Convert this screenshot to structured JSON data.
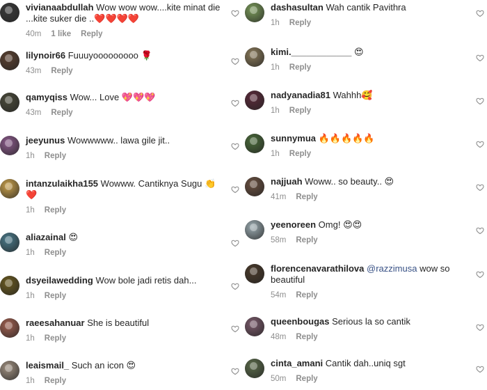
{
  "colors": {
    "text": "#262626",
    "secondary": "#8e8e8e",
    "mention": "#385185",
    "like": "#8e8e8e"
  },
  "left_comments": [
    {
      "username": "vivianaabdullah",
      "text": "Wow wow wow....kite minat die ...kite suker die ..❤️❤️❤️❤️",
      "time": "40m",
      "likes": "1 like",
      "reply": "Reply",
      "avatar_color": "#3a3a3a"
    },
    {
      "username": "lilynoir66",
      "text": "Fuuuyooooooooo 🌹",
      "time": "43m",
      "reply": "Reply",
      "avatar_color": "#5a4030"
    },
    {
      "username": "qamyqiss",
      "text": "Wow... Love 💖💖💖",
      "time": "43m",
      "reply": "Reply",
      "avatar_color": "#4a4a3a"
    },
    {
      "username": "jeeyunus",
      "text": "Wowwwww.. lawa gile jit..",
      "time": "1h",
      "reply": "Reply",
      "avatar_color": "#8a5a8a"
    },
    {
      "username": "intanzulaikha155",
      "text": "Wowww. Cantiknya Sugu 👏 ❤️",
      "time": "1h",
      "reply": "Reply",
      "avatar_color": "#c9a04a"
    },
    {
      "username": "aliazainal",
      "text": "😍",
      "time": "1h",
      "reply": "Reply",
      "avatar_color": "#4a7a8a"
    },
    {
      "username": "dsyeilawedding",
      "text": "Wow bole jadi retis dah...",
      "time": "1h",
      "reply": "Reply",
      "avatar_color": "#6a5a20"
    },
    {
      "username": "raeesahanuar",
      "text": "She is beautiful",
      "time": "1h",
      "reply": "Reply",
      "avatar_color": "#a06050"
    },
    {
      "username": "leaismail_",
      "text": "Such an icon 😍",
      "time": "1h",
      "reply": "Reply",
      "avatar_color": "#a09080"
    }
  ],
  "right_comments": [
    {
      "username": "dashasultan",
      "text": "Wah cantik Pavithra",
      "time": "1h",
      "reply": "Reply",
      "avatar_color": "#7a9a5a"
    },
    {
      "username": "kimi.____________",
      "text": "😍",
      "time": "1h",
      "reply": "Reply",
      "avatar_color": "#8a7a5a"
    },
    {
      "username": "nadyanadia81",
      "text": "Wahhh🥰",
      "time": "1h",
      "reply": "Reply",
      "avatar_color": "#5a2a3a"
    },
    {
      "username": "sunnymua",
      "text": "🔥🔥🔥🔥🔥",
      "time": "1h",
      "reply": "Reply",
      "avatar_color": "#4a6a3a"
    },
    {
      "username": "najjuah",
      "text": "Woww.. so beauty.. 😍",
      "time": "41m",
      "reply": "Reply",
      "avatar_color": "#6a5040"
    },
    {
      "username": "yeenoreen",
      "text": "Omg! 😍😍",
      "time": "58m",
      "reply": "Reply",
      "avatar_color": "#9aaab0"
    },
    {
      "username": "florencenavarathilova",
      "mention": "@razzimusa",
      "text": "wow so beautiful",
      "time": "54m",
      "reply": "Reply",
      "avatar_color": "#4a3a2a"
    },
    {
      "username": "queenbougas",
      "text": "Serious la so cantik",
      "time": "48m",
      "reply": "Reply",
      "avatar_color": "#7a5a6a"
    },
    {
      "username": "cinta_amani",
      "text": "Cantik dah..uniq sgt",
      "time": "50m",
      "reply": "Reply",
      "avatar_color": "#5a6a4a"
    }
  ]
}
